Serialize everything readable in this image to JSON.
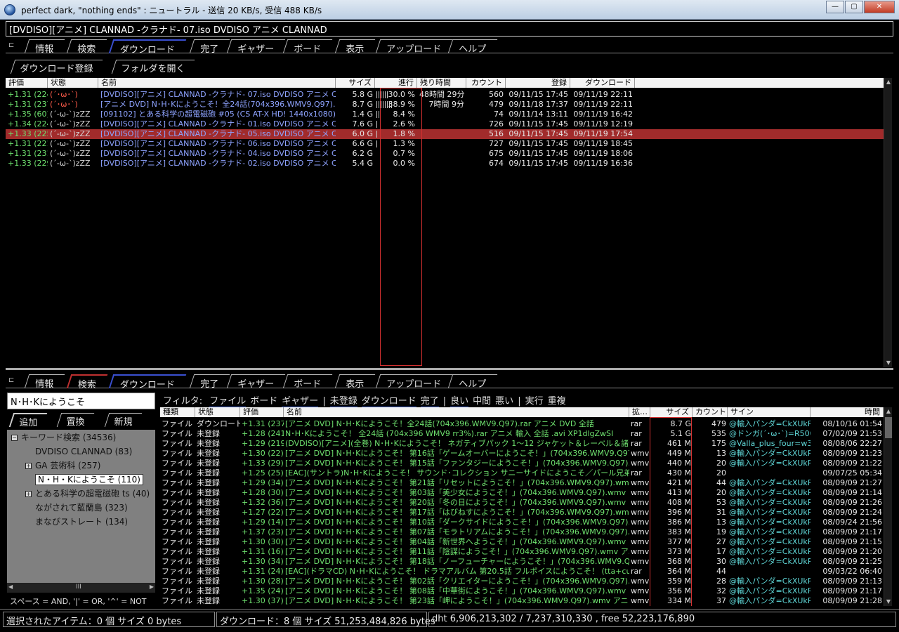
{
  "window": {
    "title": "perfect dark, \"nothing ends\" : ニュートラル - 送信  20 KB/s, 受信 488 KB/s",
    "minimize": "—",
    "maximize": "▢",
    "close": "✕"
  },
  "path": "[DVDISO][アニメ] CLANNAD -クラナド- 07.iso DVDISO アニメ CLANNAD",
  "tabs": [
    "情報",
    "検索",
    "ダウンロード",
    "完了",
    "ギャザー",
    "ボード",
    "表示",
    "アップロード",
    "ヘルプ"
  ],
  "download_buttons": {
    "register": "ダウンロード登録",
    "open_folder": "フォルダを開く"
  },
  "dl_columns": [
    "評価",
    "状態",
    "名前",
    "サイズ",
    "進行",
    "残り時間",
    "カウント",
    "登録",
    "ダウンロード"
  ],
  "downloads": [
    {
      "rating": "+1.31 (224)",
      "status": "(´･ω･`)",
      "name": "[DVDISO][アニメ] CLANNAD -クラナド- 07.iso DVDISO アニメ CLANNAD",
      "size": "5.8 G",
      "progress": "30.0 %",
      "remaining": "48時間 29分",
      "count": "560",
      "registered": "09/11/15 17:45",
      "downloaded": "09/11/19 22:11",
      "status_color": "red",
      "progress_fill": 0.3
    },
    {
      "rating": "+1.31 (237)",
      "status": "(´･ω･`)",
      "name": "[アニメ DVD] N･H･Kにようこそ！全24話(704x396.WMV9.Q97).rar アニメ DVD",
      "size": "8.7 G",
      "progress": "38.9 %",
      "remaining": "7時間 9分",
      "count": "479",
      "registered": "09/11/18 17:37",
      "downloaded": "09/11/19 22:11",
      "status_color": "red",
      "progress_fill": 0.389
    },
    {
      "rating": "+1.35 (60)",
      "status": "(´-ω-`)zZZ",
      "name": "[091102] とある科学の超電磁砲 #05 (CS AT-X HD! 1440x1080).ts",
      "size": "1.4 G",
      "progress": "8.4 %",
      "remaining": "",
      "count": "74",
      "registered": "09/11/14 13:11",
      "downloaded": "09/11/19 16:42",
      "status_color": "gray",
      "progress_fill": 0.084
    },
    {
      "rating": "+1.34 (224)",
      "status": "(´-ω-`)zZZ",
      "name": "[DVDISO][アニメ] CLANNAD -クラナド- 01.iso DVDISO アニメ CLANNAD",
      "size": "7.6 G",
      "progress": "2.6 %",
      "remaining": "",
      "count": "726",
      "registered": "09/11/15 17:45",
      "downloaded": "09/11/19 12:19",
      "status_color": "gray",
      "progress_fill": 0.026
    },
    {
      "rating": "+1.33 (225)",
      "status": "(´-ω-`)zZZ",
      "name": "[DVDISO][アニメ] CLANNAD -クラナド- 05.iso DVDISO アニメ CLANNAD",
      "size": "6.0 G",
      "progress": "1.8 %",
      "remaining": "",
      "count": "516",
      "registered": "09/11/15 17:45",
      "downloaded": "09/11/19 17:54",
      "status_color": "gray",
      "progress_fill": 0.018,
      "selected": true
    },
    {
      "rating": "+1.31 (221)",
      "status": "(´-ω-`)zZZ",
      "name": "[DVDISO][アニメ] CLANNAD -クラナド- 06.iso DVDISO アニメ CLANNAD",
      "size": "6.6 G",
      "progress": "1.3 %",
      "remaining": "",
      "count": "727",
      "registered": "09/11/15 17:45",
      "downloaded": "09/11/19 18:45",
      "status_color": "gray",
      "progress_fill": 0.013
    },
    {
      "rating": "+1.31 (231)",
      "status": "(´-ω-`)zZZ",
      "name": "[DVDISO][アニメ] CLANNAD -クラナド- 04.iso DVDISO アニメ CLANNAD",
      "size": "6.2 G",
      "progress": "0.7 %",
      "remaining": "",
      "count": "675",
      "registered": "09/11/15 17:45",
      "downloaded": "09/11/19 18:06",
      "status_color": "gray",
      "progress_fill": 0.007
    },
    {
      "rating": "+1.33 (229)",
      "status": "(´-ω-`)zZZ",
      "name": "[DVDISO][アニメ] CLANNAD -クラナド- 02.iso DVDISO アニメ CLANNAD",
      "size": "5.4 G",
      "progress": "0.0 %",
      "remaining": "",
      "count": "674",
      "registered": "09/11/15 17:45",
      "downloaded": "09/11/19 16:36",
      "status_color": "gray",
      "progress_fill": 0.0
    }
  ],
  "search": {
    "query": "N･H･Kにようこそ",
    "tabs": [
      "追加",
      "置換",
      "新規"
    ],
    "tree": [
      {
        "label": "キーワード検索 (34536)",
        "level": 0,
        "box": "−"
      },
      {
        "label": "DVDISO CLANNAD (83)",
        "level": 1,
        "box": ""
      },
      {
        "label": "GA 芸術科 (257)",
        "level": 1,
        "box": "+"
      },
      {
        "label": "N・H・Kにようこそ (110)",
        "level": 1,
        "box": "",
        "selected": true
      },
      {
        "label": "とある科学の超電磁砲 ts (40)",
        "level": 1,
        "box": "+"
      },
      {
        "label": "ながされて藍蘭島 (323)",
        "level": 1,
        "box": ""
      },
      {
        "label": "まなびストレート (134)",
        "level": 1,
        "box": ""
      }
    ],
    "hint": "スペース = AND, '|' = OR, '^' = NOT",
    "hscroll_thumb": "III"
  },
  "filter": {
    "label": "フィルタ:",
    "items": [
      "ファイル",
      "ボード",
      "ギャザー",
      "|",
      "未登録",
      "ダウンロード",
      "完了",
      "|",
      "良い",
      "中間",
      "悪い",
      "|",
      "実行",
      "重複"
    ]
  },
  "res_columns": [
    "種類",
    "状態",
    "評価",
    "名前",
    "拡…",
    "サイズ",
    "カウント",
    "サイン",
    "時間"
  ],
  "results": [
    {
      "type": "ファイル",
      "status": "ダウンロード",
      "rating": "+1.31 (237)",
      "name": "[アニメ DVD] N･H･Kにようこそ！全24話(704x396.WMV9.Q97).rar アニメ DVD 全話",
      "ext": "rar",
      "size": "8.7 G",
      "count": "479",
      "sign": "@輸入パンダ=CkXUkRi",
      "time": "08/10/16 01:54"
    },
    {
      "type": "ファイル",
      "status": "未登録",
      "rating": "+1.28 (241)",
      "name": "N･H･Kにようこそ！ 全24話 (704x396 WMV9 rr3%).rar アニメ 輸入 全話 .avi XP1dlgZwSI",
      "ext": "rar",
      "size": "5.1 G",
      "count": "535",
      "sign": "@ドンガ(´･ω･`)=R500",
      "time": "07/02/09 21:53"
    },
    {
      "type": "ファイル",
      "status": "未登録",
      "rating": "+1.29 (219)",
      "name": "(DVDISO)[アニメ](全巻) N･H･Kにようこそ！ ネガティブパック 1〜12 ジャケット＆レーベル＆諸々",
      "ext": "rar",
      "size": "461 M",
      "count": "175",
      "sign": "@Valla_plus_four=w3IiF",
      "time": "08/08/06 22:27"
    },
    {
      "type": "ファイル",
      "status": "未登録",
      "rating": "+1.30 (22)",
      "name": "[アニメ DVD] N･H･Kにようこそ！ 第16話「ゲームオーバーにようこそ！」(704x396.WMV9.Q97).wmv",
      "ext": "wmv",
      "size": "449 M",
      "count": "13",
      "sign": "@輸入パンダ=CkXUkRi",
      "time": "08/09/09 21:23"
    },
    {
      "type": "ファイル",
      "status": "未登録",
      "rating": "+1.33 (29)",
      "name": "[アニメ DVD] N･H･Kにようこそ！ 第15話「ファンタジーにようこそ！」(704x396.WMV9.Q97).wmv",
      "ext": "wmv",
      "size": "440 M",
      "count": "20",
      "sign": "@輸入パンダ=CkXUkRi",
      "time": "08/09/09 21:22"
    },
    {
      "type": "ファイル",
      "status": "未登録",
      "rating": "+1.25 (25)",
      "name": "[EAC](サントラ)N･H･Kにようこそ！ サウンド･コレクション サニーサイドにようこそ／パール兄弟",
      "ext": "rar",
      "size": "430 M",
      "count": "20",
      "sign": "",
      "time": "09/07/25 05:34"
    },
    {
      "type": "ファイル",
      "status": "未登録",
      "rating": "+1.29 (34)",
      "name": "[アニメ DVD] N･H･Kにようこそ！ 第21話「リセットにようこそ！」(704x396.WMV9.Q97).wmv アニメ",
      "ext": "wmv",
      "size": "421 M",
      "count": "44",
      "sign": "@輸入パンダ=CkXUkRi",
      "time": "08/09/09 21:27"
    },
    {
      "type": "ファイル",
      "status": "未登録",
      "rating": "+1.28 (30)",
      "name": "[アニメ DVD] N･H･Kにようこそ！ 第03話「美少女にようこそ！」(704x396.WMV9.Q97).wmv アニメ",
      "ext": "wmv",
      "size": "413 M",
      "count": "20",
      "sign": "@輸入パンダ=CkXUkRi",
      "time": "08/09/09 21:14"
    },
    {
      "type": "ファイル",
      "status": "未登録",
      "rating": "+1.32 (36)",
      "name": "[アニメ DVD] N･H･Kにようこそ！ 第20話「冬の日にようこそ！」(704x396.WMV9.Q97).wmv アニメ",
      "ext": "wmv",
      "size": "408 M",
      "count": "53",
      "sign": "@輸入パンダ=CkXUkRi",
      "time": "08/09/09 21:26"
    },
    {
      "type": "ファイル",
      "status": "未登録",
      "rating": "+1.27 (22)",
      "name": "[アニメ DVD] N･H･Kにようこそ！ 第17話「はびねすにようこそ！」(704x396.WMV9.Q97).wmv アニメ",
      "ext": "wmv",
      "size": "396 M",
      "count": "31",
      "sign": "@輸入パンダ=CkXUkRi",
      "time": "08/09/09 21:24"
    },
    {
      "type": "ファイル",
      "status": "未登録",
      "rating": "+1.29 (14)",
      "name": "[アニメ DVD] N･H･Kにようこそ！ 第10話「ダークサイドにようこそ！」(704x396.WMV9.Q97).wmv アニメ",
      "ext": "wmv",
      "size": "386 M",
      "count": "13",
      "sign": "@輸入パンダ=CkXUkRi",
      "time": "08/09/24 21:56"
    },
    {
      "type": "ファイル",
      "status": "未登録",
      "rating": "+1.37 (23)",
      "name": "[アニメ DVD] N･H･Kにようこそ！ 第07話「モラトリアムにようこそ！」(704x396.WMV9.Q97).wmv アニメ",
      "ext": "wmv",
      "size": "383 M",
      "count": "19",
      "sign": "@輸入パンダ=CkXUkRi",
      "time": "08/09/09 21:17"
    },
    {
      "type": "ファイル",
      "status": "未登録",
      "rating": "+1.30 (30)",
      "name": "[アニメ DVD] N･H･Kにようこそ！ 第04話「新世界へようこそ！」(704x396.WMV9.Q97).wmv アニメ",
      "ext": "wmv",
      "size": "377 M",
      "count": "27",
      "sign": "@輸入パンダ=CkXUkRi",
      "time": "08/09/09 21:15"
    },
    {
      "type": "ファイル",
      "status": "未登録",
      "rating": "+1.31 (16)",
      "name": "[アニメ DVD] N･H･Kにようこそ！ 第11話「陰謀にようこそ！」(704x396.WMV9.Q97).wmv アニメ DVD",
      "ext": "wmv",
      "size": "373 M",
      "count": "17",
      "sign": "@輸入パンダ=CkXUkRi",
      "time": "08/09/09 21:20"
    },
    {
      "type": "ファイル",
      "status": "未登録",
      "rating": "+1.30 (34)",
      "name": "[アニメ DVD] N･H･Kにようこそ！ 第18話「ノーフューチャーにようこそ！」(704x396.WMV9.Q97).wmv",
      "ext": "wmv",
      "size": "368 M",
      "count": "30",
      "sign": "@輸入パンダ=CkXUkRi",
      "time": "08/09/09 21:25"
    },
    {
      "type": "ファイル",
      "status": "未登録",
      "rating": "+1.31 (24)",
      "name": "[EAC](ドラマCD) N･H･Kにようこそ！ ドラマアルバム 第20.5話 フルボイスにようこそ！ (tta+cue)",
      "ext": "rar",
      "size": "364 M",
      "count": "44",
      "sign": "",
      "time": "09/03/22 06:40"
    },
    {
      "type": "ファイル",
      "status": "未登録",
      "rating": "+1.30 (28)",
      "name": "[アニメ DVD] N･H･Kにようこそ！ 第02話「クリエイターにようこそ！」(704x396.WMV9.Q97).wmv アニメ",
      "ext": "wmv",
      "size": "359 M",
      "count": "28",
      "sign": "@輸入パンダ=CkXUkRi",
      "time": "08/09/09 21:13"
    },
    {
      "type": "ファイル",
      "status": "未登録",
      "rating": "+1.35 (24)",
      "name": "[アニメ DVD] N･H･Kにようこそ！ 第08話「中華街にようこそ！」(704x396.WMV9.Q97).wmv アニメ",
      "ext": "wmv",
      "size": "356 M",
      "count": "32",
      "sign": "@輸入パンダ=CkXUkRi",
      "time": "08/09/09 21:17"
    },
    {
      "type": "ファイル",
      "status": "未登録",
      "rating": "+1.30 (37)",
      "name": "[アニメ DVD] N･H･Kにようこそ！ 第23話「岬にようこそ！」(704x396.WMV9.Q97).wmv アニメ DVD",
      "ext": "wmv",
      "size": "334 M",
      "count": "37",
      "sign": "@輸入パンダ=CkXUkRi",
      "time": "08/09/09 21:28"
    }
  ],
  "status": {
    "selected": "選択されたアイテム：0 個  サイズ 0 bytes",
    "downloads": "ダウンロード：8 個  サイズ 51,253,484,826 bytes",
    "dht": "dht 6,906,213,302 / 7,237,310,330 , free 52,223,176,890"
  },
  "colors": {
    "accent_blue": "#3a4fd0",
    "highlight_red": "#a12b2b",
    "rating_green": "#6ee06e",
    "name_blue": "#8ea3ff",
    "sign_cyan": "#5fd6d6"
  }
}
